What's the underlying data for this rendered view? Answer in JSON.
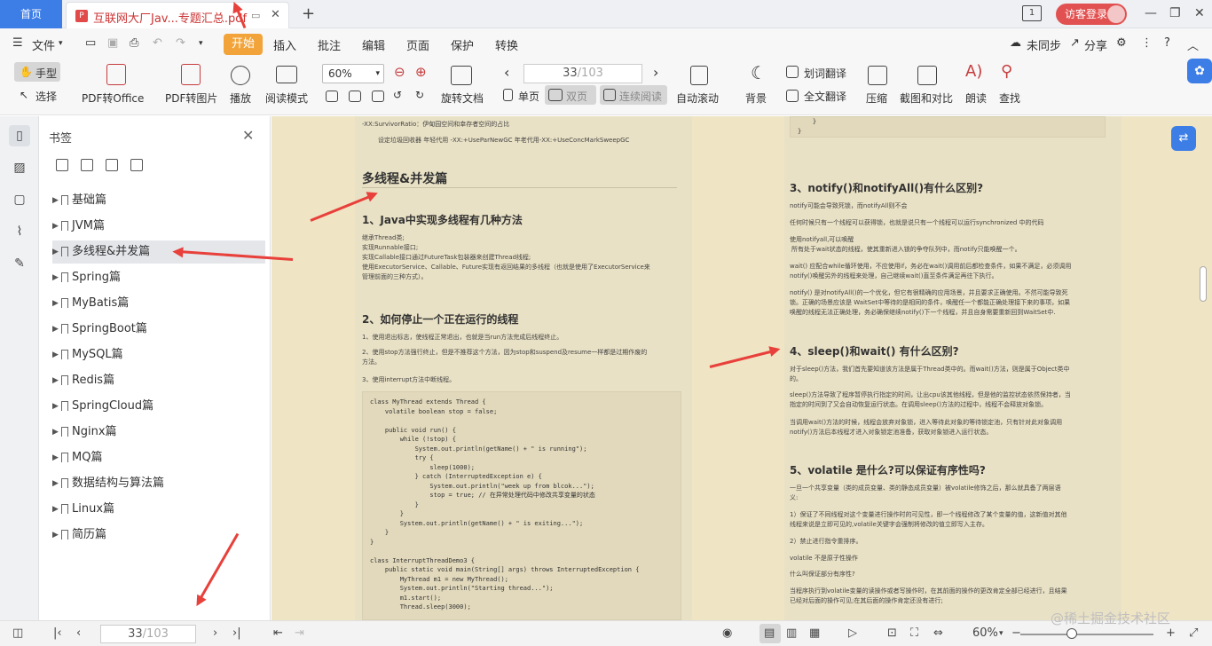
{
  "tabs": {
    "home": "首页",
    "doc_title": "互联网大厂Jav...专题汇总.pdf"
  },
  "header": {
    "guest_login": "访客登录"
  },
  "menu": {
    "file": "文件",
    "start": "开始",
    "insert": "插入",
    "annotate": "批注",
    "edit": "编辑",
    "page": "页面",
    "protect": "保护",
    "convert": "转换",
    "unsynced": "未同步",
    "share": "分享"
  },
  "toolbar": {
    "hand": "手型",
    "select": "选择",
    "pdf_to_office": "PDF转Office",
    "pdf_to_image": "PDF转图片",
    "play": "播放",
    "read_mode": "阅读模式",
    "zoom": "60%",
    "rotate": "旋转文档",
    "page_current": "33",
    "page_total": "/103",
    "single": "单页",
    "double": "双页",
    "continuous": "连续阅读",
    "auto_scroll": "自动滚动",
    "background": "背景",
    "word_translate": "划词翻译",
    "full_translate": "全文翻译",
    "compress": "压缩",
    "screenshot_compare": "截图和对比",
    "read_aloud": "朗读",
    "find": "查找"
  },
  "bookmarks": {
    "title": "书签",
    "items": [
      "基础篇",
      "JVM篇",
      "多线程&并发篇",
      "Spring篇",
      "MyBatis篇",
      "SpringBoot篇",
      "MySQL篇",
      "Redis篇",
      "SpringCloud篇",
      "Nginx篇",
      "MQ篇",
      "数据结构与算法篇",
      "Linux篇",
      "简历篇"
    ]
  },
  "left_page": {
    "top1": "-XX:SurvivorRatio：伊甸园空间和幸存者空间的占比",
    "top2": "设定垃圾回收器 年轻代用 -XX:+UseParNewGC 年老代用-XX:+UseConcMarkSweepGC",
    "section": "多线程&并发篇",
    "q1": "1、Java中实现多线程有几种方法",
    "q1_l1": "继承Thread类;",
    "q1_l2": "实现Runnable接口;",
    "q1_l3": "实现Callable接口通过FutureTask包装器来创建Thread线程;",
    "q1_l4": "使用ExecutorService、Callable、Future实现有返回结果的多线程（也就是使用了ExecutorService来",
    "q1_l5": "管理前面的三种方式）。",
    "q2": "2、如何停止一个正在运行的线程",
    "q2_l1": "1、使用退出标志，使线程正常退出，也就是当run方法完成后线程终止。",
    "q2_l2": "2、使用stop方法强行终止，但是不推荐这个方法，因为stop和suspend及resume一样都是过期作废的",
    "q2_l3": "方法。",
    "q2_l4": "3、使用interrupt方法中断线程。",
    "code1": "class MyThread extends Thread {\n    volatile boolean stop = false;\n\n    public void run() {\n        while (!stop) {\n            System.out.println(getName() + \" is running\");\n            try {\n                sleep(1000);\n            } catch (InterruptedException e) {\n                System.out.println(\"week up from blcok...\");\n                stop = true; // 在异常处理代码中修改共享变量的状态\n            }\n        }\n        System.out.println(getName() + \" is exiting...\");\n    }\n}\n\nclass InterruptThreadDemo3 {\n    public static void main(String[] args) throws InterruptedException {\n        MyThread m1 = new MyThread();\n        System.out.println(\"Starting thread...\");\n        m1.start();\n        Thread.sleep(3000);"
  },
  "right_page": {
    "code_top": "    }\n}",
    "q3": "3、notify()和notifyAll()有什么区别?",
    "q3_l1": "notify可能会导致死锁，而notifyAll则不会",
    "q3_l2": "任何时候只有一个线程可以获得锁，也就是说只有一个线程可以运行synchronized 中的代码",
    "q3_l3": "使用notifyall,可以唤醒",
    "q3_l4": "所有处于wait状态的线程，使其重新进入锁的争夺队列中，而notify只能唤醒一个。",
    "q3_l5": "wait() 应配合while循环使用，不应使用if，务必在wait()调用前后都检查条件，如果不满足，必须调用",
    "q3_l6": "notify()唤醒另外的线程来处理，自己继续wait()直至条件满足再往下执行。",
    "q3_l7": "notify() 是对notifyAll()的一个优化，但它有很精确的应用场景，并且要求正确使用。不然可能导致死",
    "q3_l8": "锁。正确的场景应该是 WaitSet中等待的是相同的条件，唤醒任一个都能正确处理接下来的事项，如果",
    "q3_l9": "唤醒的线程无法正确处理，务必确保继续notify()下一个线程，并且自身需要重新回到WaitSet中.",
    "q4": "4、sleep()和wait() 有什么区别?",
    "q4_l1": "对于sleep()方法，我们首先要知道该方法是属于Thread类中的。而wait()方法，则是属于Object类中",
    "q4_l2": "的。",
    "q4_l3": "sleep()方法导致了程序暂停执行指定的时间，让出cpu该其他线程，但是他的监控状态依然保持者，当",
    "q4_l4": "指定的时间到了又会自动恢复运行状态。在调用sleep()方法的过程中，线程不会释放对象锁。",
    "q4_l5": "当调用wait()方法的时候，线程会放弃对象锁，进入等待此对象的等待锁定池，只有针对此对象调用",
    "q4_l6": "notify()方法后本线程才进入对象锁定池准备，获取对象锁进入运行状态。",
    "q5": "5、volatile 是什么?可以保证有序性吗?",
    "q5_l1": "一旦一个共享变量（类的成员变量、类的静态成员变量）被volatile修饰之后，那么就具备了两层语",
    "q5_l2": "义:",
    "q5_l3": "1）保证了不同线程对这个变量进行操作时的可见性，即一个线程修改了某个变量的值，这新值对其他",
    "q5_l4": "线程来说是立即可见的,volatile关键字会强制将修改的值立即写入主存。",
    "q5_l5": "2）禁止进行指令重排序。",
    "q5_l6": "volatile 不是原子性操作",
    "q5_l7": "什么叫保证部分有序性?",
    "q5_l8": "当程序执行到volatile变量的读操作或者写操作时，在其前面的操作的更改肯定全部已经进行，且结果",
    "q5_l9": "已经对后面的操作可见;在其后面的操作肯定还没有进行;"
  },
  "status": {
    "page_current": "33",
    "page_total": "/103",
    "zoom": "60%"
  },
  "watermark": "@稀土掘金技术社区"
}
